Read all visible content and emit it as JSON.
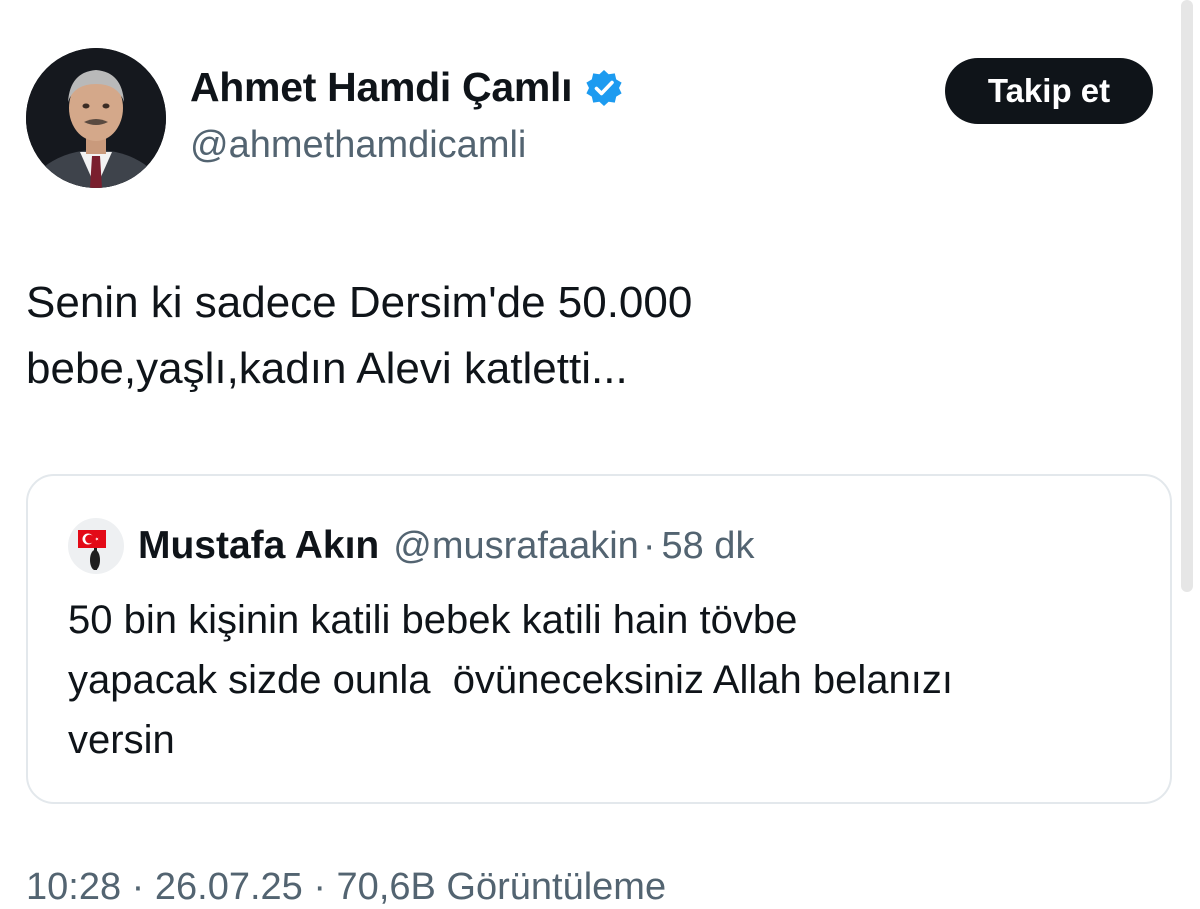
{
  "author": {
    "display_name": "Ahmet Hamdi Çamlı",
    "handle": "@ahmethamdicamli",
    "avatar_icon": "profile-photo",
    "verified_icon": "verified-badge-icon",
    "verified_color": "#1d9bf0"
  },
  "follow_button": {
    "label": "Takip et"
  },
  "tweet": {
    "lines": [
      "Senin ki sadece Dersim'de 50.000",
      "bebe,yaşlı,kadın Alevi katletti..."
    ]
  },
  "quoted_tweet": {
    "display_name": "Mustafa Akın",
    "handle": "@musrafaakin",
    "separator": "·",
    "time": "58 dk",
    "avatar_icon": "turkish-flag-avatar",
    "lines": [
      "50 bin kişinin katili bebek katili hain tövbe",
      "yapacak sizde ounla  övüneceksiniz Allah belanızı",
      "versin"
    ]
  },
  "meta": {
    "text": "10:28 · 26.07.25 · 70,6B Görüntüleme"
  },
  "colors": {
    "text": "#0f1419",
    "secondary": "#536471",
    "button_bg": "#0f1419",
    "card_border": "#e3e8ec"
  }
}
